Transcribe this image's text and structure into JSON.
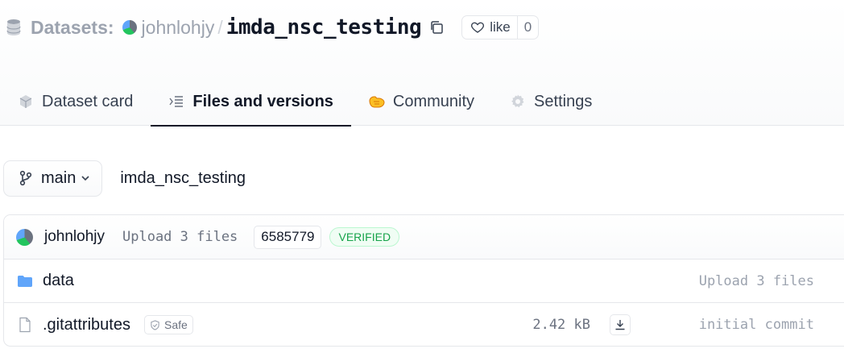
{
  "header": {
    "section_label": "Datasets:",
    "owner": "johnlohjy",
    "separator": "/",
    "repo_name": "imda_nsc_testing",
    "like_label": "like",
    "like_count": "0"
  },
  "tabs": [
    {
      "label": "Dataset card",
      "icon": "cube-icon",
      "active": false
    },
    {
      "label": "Files and versions",
      "icon": "files-icon",
      "active": true
    },
    {
      "label": "Community",
      "icon": "handshake-icon",
      "active": false
    },
    {
      "label": "Settings",
      "icon": "gear-icon",
      "active": false
    }
  ],
  "branch": {
    "name": "main",
    "path": "imda_nsc_testing"
  },
  "last_commit": {
    "user": "johnlohjy",
    "message": "Upload 3 files",
    "hash": "6585779",
    "status": "VERIFIED"
  },
  "files": [
    {
      "type": "folder",
      "name": "data",
      "size": "",
      "safe_label": "",
      "last_commit": "Upload 3 files"
    },
    {
      "type": "file",
      "name": ".gitattributes",
      "size": "2.42 kB",
      "safe_label": "Safe",
      "last_commit": "initial commit"
    }
  ],
  "colors": {
    "accent_green": "#16a34a",
    "folder_blue": "#60a5fa",
    "muted_gray": "#9ca3af"
  }
}
